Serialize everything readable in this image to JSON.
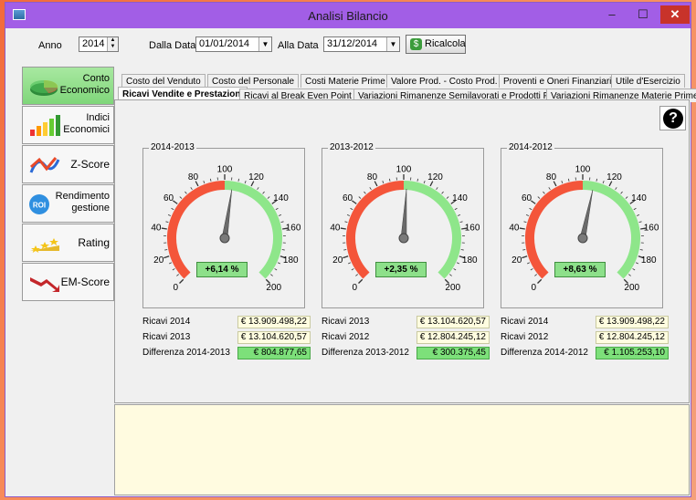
{
  "window": {
    "title": "Analisi Bilancio",
    "close_glyph": "✕",
    "minimize_glyph": "–",
    "maximize_glyph": "☐"
  },
  "toolbar": {
    "anno_label": "Anno",
    "anno_value": "2014",
    "dalla_label": "Dalla Data",
    "dalla_value": "01/01/2014",
    "alla_label": "Alla Data",
    "alla_value": "31/12/2014",
    "ricalcola_label": "Ricalcola"
  },
  "nav": [
    {
      "label_line1": "Conto",
      "label_line2": "Economico",
      "icon": "pie-chart-icon",
      "active": true
    },
    {
      "label_line1": "Indici",
      "label_line2": "Economici",
      "icon": "bar-chart-icon"
    },
    {
      "label_line1": "Z-Score",
      "label_line2": "",
      "icon": "zscore-icon"
    },
    {
      "label_line1": "Rendimento",
      "label_line2": "gestione",
      "icon": "roi-icon",
      "icon_text": "ROI"
    },
    {
      "label_line1": "Rating",
      "label_line2": "",
      "icon": "stars-icon"
    },
    {
      "label_line1": "EM-Score",
      "label_line2": "",
      "icon": "arrow-down-icon"
    }
  ],
  "tabs_row1": [
    "Costo del Venduto",
    "Costo del Personale",
    "Costi Materie Prime",
    "Valore Prod. - Costo Prod.",
    "Proventi e Oneri Finanziari",
    "Utile d'Esercizio"
  ],
  "tabs_row2": [
    "Ricavi Vendite e Prestazioni",
    "Ricavi al Break Even Point",
    "Variazioni Rimanenze Semilavorati e Prodotti Finiti",
    "Variazioni Rimanenze Materie Prime"
  ],
  "help_glyph": "?",
  "gauges": [
    {
      "title": "2014-2013",
      "value": 106.14,
      "display": "+6,14 %",
      "rows": [
        {
          "label": "Ricavi 2014",
          "value": "€ 13.909.498,22"
        },
        {
          "label": "Ricavi 2013",
          "value": "€ 13.104.620,57"
        },
        {
          "label": "Differenza 2014-2013",
          "value": "€ 804.877,65"
        }
      ]
    },
    {
      "title": "2013-2012",
      "value": 102.35,
      "display": "+2,35 %",
      "rows": [
        {
          "label": "Ricavi 2013",
          "value": "€ 13.104.620,57"
        },
        {
          "label": "Ricavi 2012",
          "value": "€ 12.804.245,12"
        },
        {
          "label": "Differenza 2013-2012",
          "value": "€ 300.375,45"
        }
      ]
    },
    {
      "title": "2014-2012",
      "value": 108.63,
      "display": "+8,63 %",
      "rows": [
        {
          "label": "Ricavi 2014",
          "value": "€ 13.909.498,22"
        },
        {
          "label": "Ricavi 2012",
          "value": "€ 12.804.245,12"
        },
        {
          "label": "Differenza 2014-2012",
          "value": "€ 1.105.253,10"
        }
      ]
    }
  ],
  "gauge_ticks": [
    "0",
    "20",
    "40",
    "60",
    "80",
    "100",
    "120",
    "140",
    "160",
    "180",
    "200"
  ],
  "gauge_range": [
    0,
    200
  ],
  "colors": {
    "red_zone": "#f4553a",
    "green_zone": "#8ee68a",
    "accent": "#a25ee6"
  }
}
